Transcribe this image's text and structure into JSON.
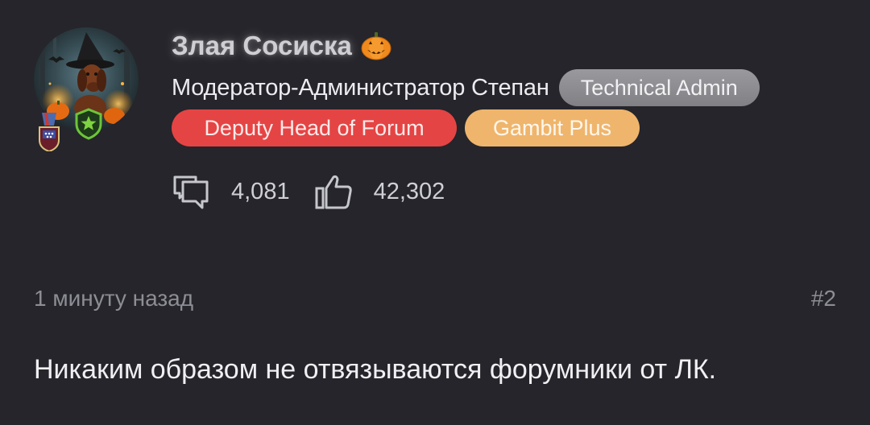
{
  "post": {
    "author": {
      "name": "Злая Сосиска",
      "name_emoji": "pumpkin-icon",
      "title": "Модератор-Администратор Степан",
      "badges": [
        {
          "label": "Technical Admin",
          "color": "#8e8e93"
        },
        {
          "label": "Deputy Head of Forum",
          "color": "#e54444"
        },
        {
          "label": "Gambit Plus",
          "color": "#efb56c"
        }
      ],
      "stats": {
        "messages_icon": "comments-icon",
        "messages": "4,081",
        "likes_icon": "thumbs-up-icon",
        "likes": "42,302"
      }
    },
    "time": "1 минуту назад",
    "number": "#2",
    "message": "Никаким образом не отвязываются форумники от ЛК."
  },
  "colors": {
    "background": "#25252b",
    "text": "#ececf0",
    "muted": "#8d8d95"
  }
}
